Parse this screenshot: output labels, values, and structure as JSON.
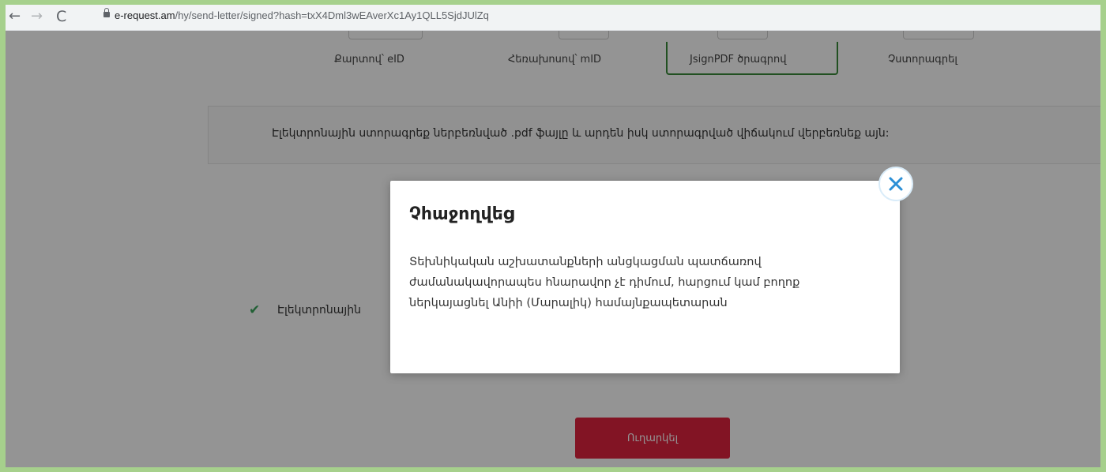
{
  "browser": {
    "url_domain": "e-request.am",
    "url_path": "/hy/send-letter/signed?hash=txX4Dml3wEAverXc1Ay1QLL5SjdJUlZq",
    "back_icon": "←",
    "forward_icon": "→",
    "reload_icon": "C"
  },
  "steps": [
    {
      "label": "Քարտով՝ eID"
    },
    {
      "label": "Հեռախոսով՝ mID"
    },
    {
      "label": "JsignPDF ծրագրով"
    },
    {
      "label": "Չստորագրել"
    }
  ],
  "instruction": "Էլեկտրոնային ստորագրեք ներբեռնված .pdf ֆայլը և արդեն իսկ ստորագրված վիճակում վերբեռնեք այն:",
  "checkbox_label": "Էլեկտրոնային",
  "submit_label": "Ուղարկել",
  "modal": {
    "title": "Չհաջողվեց",
    "body_lines": [
      "Տեխնիկական աշխատանքների անցկացման պատճառով",
      "ժամանակավորապես հնարավոր չէ դիմում, հարցում կամ բողոք",
      "ներկայացնել Անիի (Մարալիկ) համայնքապետարան"
    ]
  },
  "colors": {
    "page_background": "#a6d08c",
    "submit_button": "#e0233f",
    "active_step_border": "#3a8a3a",
    "check": "#3ba55c",
    "close_icon": "#2b8fd6"
  }
}
